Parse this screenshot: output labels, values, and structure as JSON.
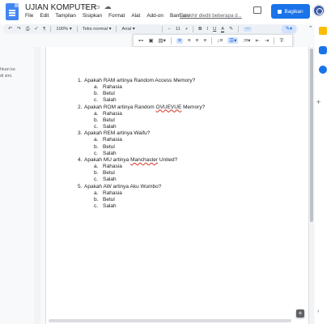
{
  "app": {
    "title": "UJIAN KOMPUTER",
    "last_edit": "Terakhir diedit beberapa d...",
    "share_label": "Bagikan"
  },
  "menu": [
    "File",
    "Edit",
    "Tampilan",
    "Sisipkan",
    "Format",
    "Alat",
    "Add-on",
    "Bantuan"
  ],
  "toolbar": {
    "zoom": "100%",
    "style": "Teks normal",
    "font": "Arial",
    "font_size": "11"
  },
  "side_hint": [
    "hkan ke",
    "di sini."
  ],
  "questions": [
    {
      "num": "1.",
      "text": "Apakah RAM artinya Random Access Memory?",
      "options": [
        "Rahasia",
        "Betul",
        "Salah"
      ]
    },
    {
      "num": "2.",
      "text_before": "Apakah ROM artinya Random ",
      "text_underlined": "OVUEVUE",
      "text_after": " Memory?",
      "options": [
        "Rahasia",
        "Betul",
        "Salah"
      ]
    },
    {
      "num": "3.",
      "text": "Apakah REM artinya Waifu?",
      "options": [
        "Rahasia",
        "Betul",
        "Salah"
      ]
    },
    {
      "num": "4.",
      "text_before": "Apakah MU artinya ",
      "text_underlined": "Manchaster",
      "text_after": " United?",
      "options": [
        "Rahasia",
        "Betul",
        "Salah"
      ]
    },
    {
      "num": "5.",
      "text": "Apakah AW artinya Aku Wumbo?",
      "options": [
        "Rahasia",
        "Betul",
        "Salah"
      ]
    }
  ],
  "option_letters": [
    "a.",
    "b.",
    "c."
  ],
  "colors": {
    "accent": "#1a73e8",
    "rail_yellow": "#fbbc04",
    "rail_green": "#34a853",
    "rail_blue": "#1a73e8"
  }
}
